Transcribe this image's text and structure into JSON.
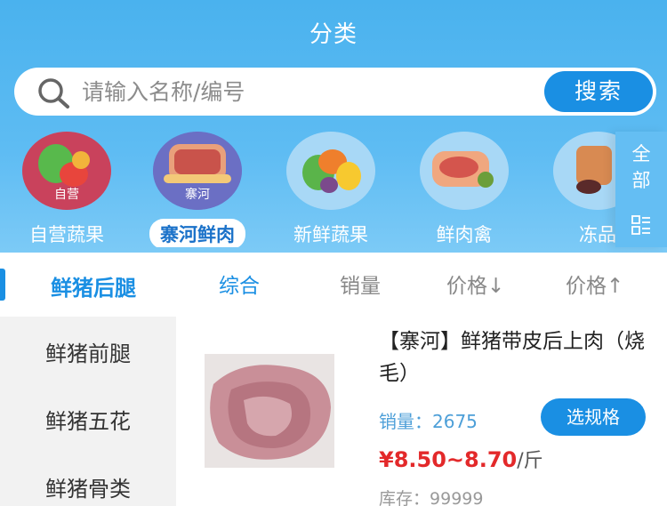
{
  "header": {
    "title": "分类"
  },
  "search": {
    "placeholder": "请输入名称/编号",
    "button_label": "搜索"
  },
  "categories": [
    {
      "label": "自营蔬果",
      "tag": "自营",
      "active": false
    },
    {
      "label": "寨河鲜肉",
      "tag": "寨河",
      "active": true
    },
    {
      "label": "新鲜蔬果",
      "active": false
    },
    {
      "label": "鲜肉禽",
      "active": false
    },
    {
      "label": "冻品",
      "active": false
    }
  ],
  "all_categories": {
    "label": "全部"
  },
  "sidebar": {
    "active": "鲜猪后腿",
    "items": [
      "鲜猪前腿",
      "鲜猪五花",
      "鲜猪骨类"
    ]
  },
  "sort": {
    "items": [
      "综合",
      "销量",
      "价格↓",
      "价格↑"
    ],
    "active_index": 0
  },
  "product": {
    "title": "【寨河】鲜猪带皮后上肉（烧毛）",
    "sales_label": "销量：",
    "sales_value": "2675",
    "spec_button": "选规格",
    "price": "¥8.50~8.70",
    "price_unit": "/斤",
    "stock_label": "库存：",
    "stock_value": "99999"
  },
  "colors": {
    "accent": "#1a8fe3",
    "header": "#5ebcf3",
    "price": "#e3292a"
  }
}
